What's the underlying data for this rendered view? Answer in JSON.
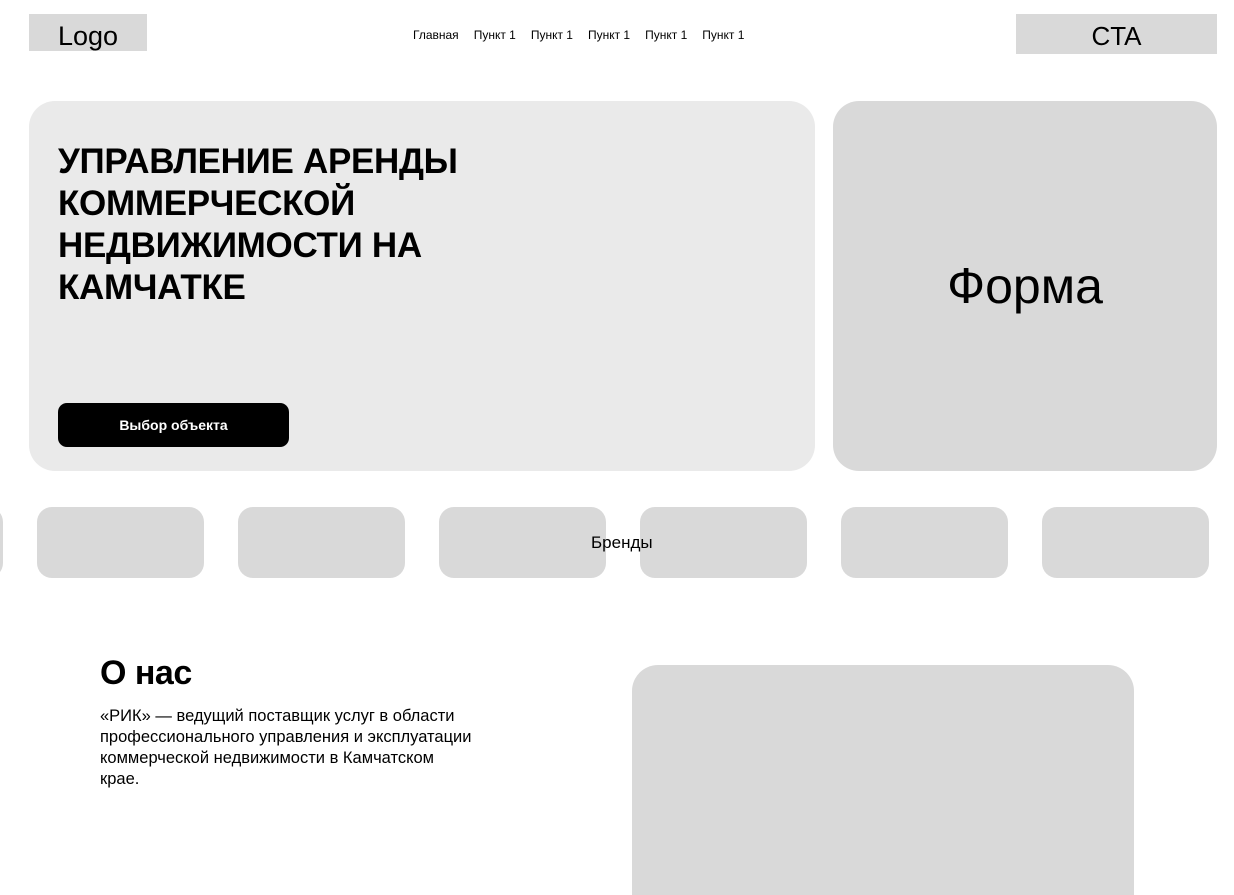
{
  "header": {
    "logo": "Logo",
    "nav": [
      "Главная",
      "Пункт 1",
      "Пункт 1",
      "Пункт 1",
      "Пункт 1",
      "Пункт 1"
    ],
    "cta": "CTA"
  },
  "hero": {
    "title_lines": [
      "УПРАВЛЕНИЕ АРЕНДЫ",
      "КОММЕРЧЕСКОЙ",
      "НЕДВИЖИМОСТИ НА",
      "КАМЧАТКЕ"
    ],
    "button": "Выбор объекта",
    "form_label": "Форма"
  },
  "brands": {
    "label": "Бренды"
  },
  "about": {
    "title": "О нас",
    "text_lines": [
      "«РИК» — ведущий поставщик услуг в области",
      "профессионального управления и эксплуатации",
      "коммерческой недвижимости в Камчатском",
      "крае."
    ]
  },
  "colors": {
    "placeholder": "#d9d9d9",
    "hero_bg": "#eaeaea",
    "button_bg": "#000000",
    "button_text": "#ffffff"
  }
}
